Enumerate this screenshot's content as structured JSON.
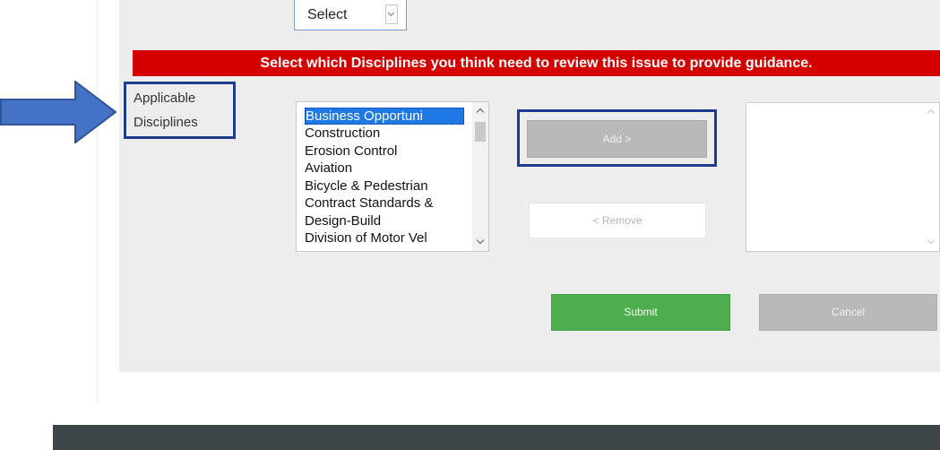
{
  "top_select": {
    "value": "Select"
  },
  "banner": {
    "text": "Select which Disciplines you think need to review this issue to provide guidance."
  },
  "field_label": {
    "line1": "Applicable",
    "line2": "Disciplines"
  },
  "disciplines_list": {
    "items": [
      "Business Opportuni",
      "Construction",
      "Erosion Control",
      "Aviation",
      "Bicycle & Pedestrian",
      "Contract Standards &",
      "Design-Build",
      "Division of Motor Vel"
    ],
    "selected_index": 0
  },
  "buttons": {
    "add": "Add >",
    "remove": "< Remove",
    "submit": "Submit",
    "cancel": "Cancel"
  },
  "colors": {
    "banner": "#d40000",
    "annotation": "#1e3c8c",
    "arrow": "#4472c4",
    "submit": "#4cae4c",
    "disabled": "#b9b9b9",
    "selection": "#1e78e6",
    "footer": "#3c4548"
  },
  "icons": {
    "annotation_arrow": "right-arrow-icon",
    "select_arrow": "chevron-down-icon",
    "scroll_up": "chevron-up-icon",
    "scroll_down": "chevron-down-icon"
  }
}
